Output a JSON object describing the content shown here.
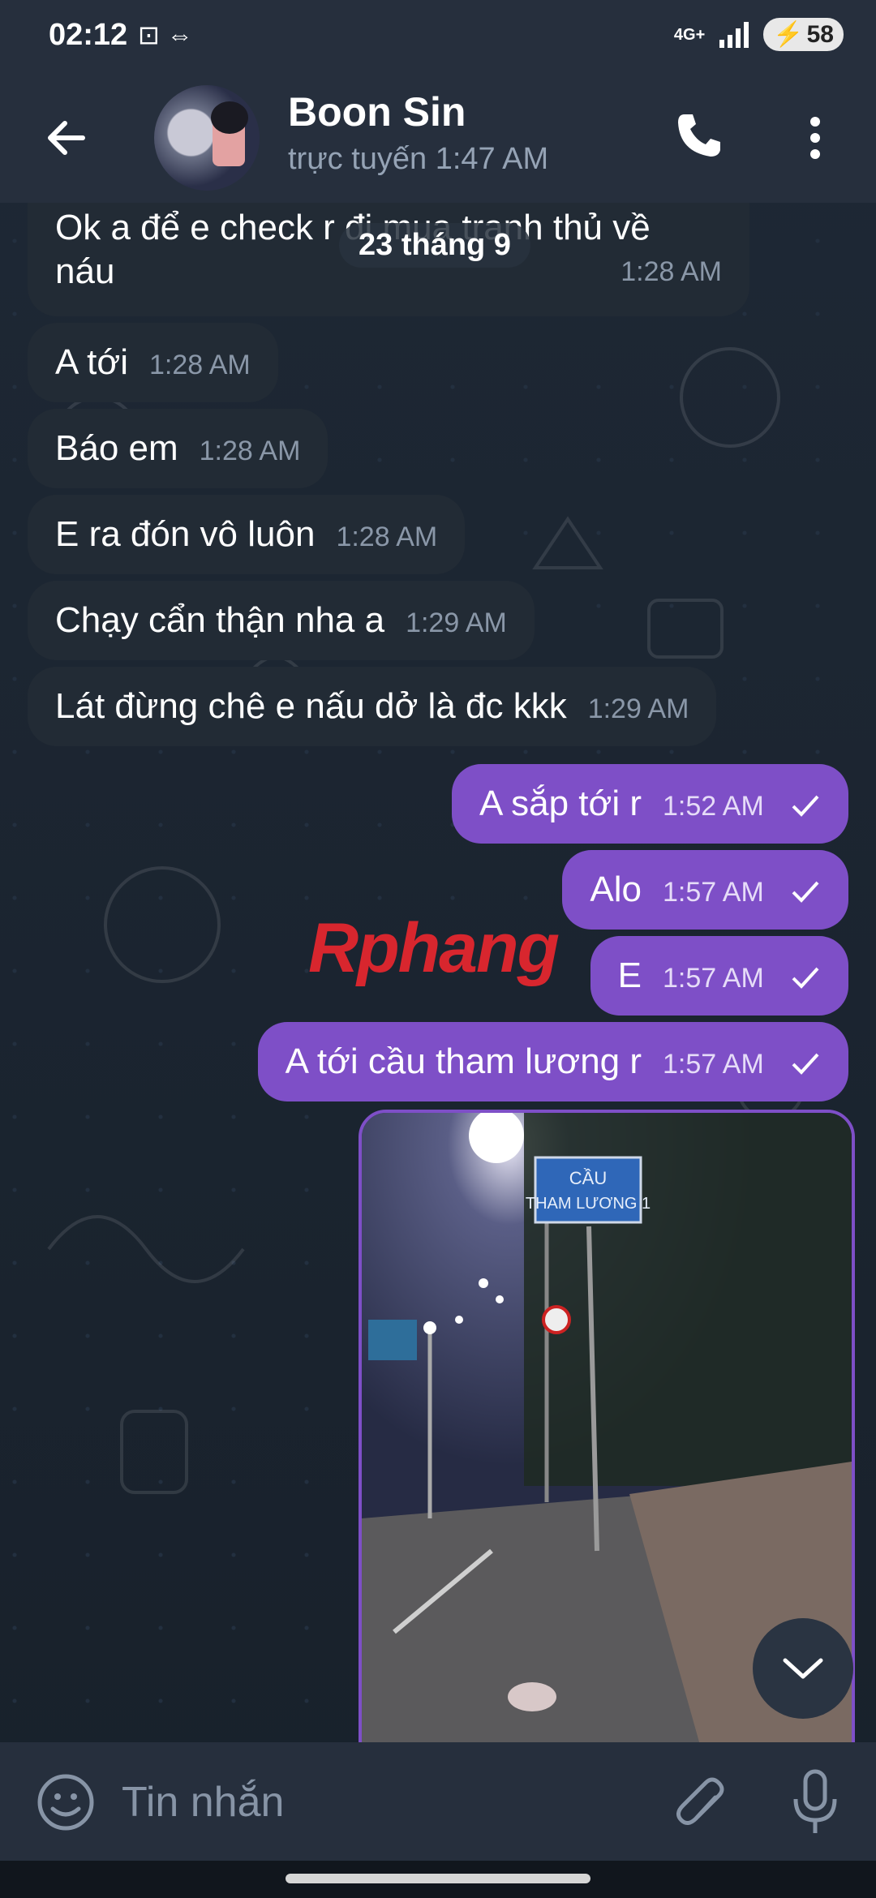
{
  "status_bar": {
    "time": "02:12",
    "network": "4G+",
    "battery": "58"
  },
  "header": {
    "contact_name": "Boon Sin",
    "status": "trực tuyến 1:47 AM"
  },
  "date_chip": "23 tháng 9",
  "messages": [
    {
      "text": "Ok a để e check r đi mua tranh thủ về",
      "text2": "náu",
      "time": "1:28 AM",
      "dir": "in"
    },
    {
      "text": "A tới",
      "time": "1:28 AM",
      "dir": "in"
    },
    {
      "text": "Báo em",
      "time": "1:28 AM",
      "dir": "in"
    },
    {
      "text": "E ra đón vô luôn",
      "time": "1:28 AM",
      "dir": "in"
    },
    {
      "text": "Chạy cẩn thận nha a",
      "time": "1:29 AM",
      "dir": "in"
    },
    {
      "text": "Lát đừng chê e nấu dở là đc kkk",
      "time": "1:29 AM",
      "dir": "in"
    },
    {
      "text": "A sắp tới r",
      "time": "1:52 AM",
      "dir": "out"
    },
    {
      "text": "Alo",
      "time": "1:57 AM",
      "dir": "out"
    },
    {
      "text": "E",
      "time": "1:57 AM",
      "dir": "out"
    },
    {
      "text": "A tới cầu tham lương r",
      "time": "1:57 AM",
      "dir": "out"
    }
  ],
  "photo": {
    "sign_line1": "CẦU",
    "sign_line2": "THAM LƯƠNG 1"
  },
  "watermark": "Rphang",
  "composer": {
    "placeholder": "Tin nhắn"
  },
  "colors": {
    "outgoing": "#7e4fc7",
    "incoming": "#222b35",
    "background": "#1b2430"
  },
  "icons": [
    "back-arrow-icon",
    "phone-icon",
    "more-vertical-icon",
    "emoji-icon",
    "attach-icon",
    "mic-icon",
    "chevron-down-icon",
    "check-icon"
  ]
}
